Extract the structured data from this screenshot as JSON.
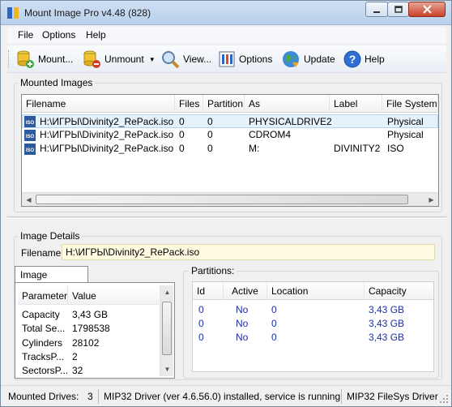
{
  "window": {
    "title": "Mount Image Pro v4.48 (828)"
  },
  "menu": [
    "File",
    "Options",
    "Help"
  ],
  "toolbar": {
    "mount": "Mount...",
    "unmount": "Unmount",
    "view": "View...",
    "options": "Options",
    "update": "Update",
    "help": "Help"
  },
  "mounted": {
    "group_label": "Mounted Images",
    "columns": [
      "Filename",
      "Files",
      "Partition",
      "As",
      "Label",
      "File System"
    ],
    "rows": [
      {
        "filename": "H:\\ИГРЫ\\Divinity2_RePack.iso",
        "files": "0",
        "partition": "0",
        "as": "PHYSICALDRIVE2",
        "label": "",
        "fs": "Physical",
        "icon": "iso-icon"
      },
      {
        "filename": "H:\\ИГРЫ\\Divinity2_RePack.iso",
        "files": "0",
        "partition": "0",
        "as": "CDROM4",
        "label": "",
        "fs": "Physical",
        "icon": "iso-icon"
      },
      {
        "filename": "H:\\ИГРЫ\\Divinity2_RePack.iso",
        "files": "0",
        "partition": "0",
        "as": "M:",
        "label": "DIVINITY2",
        "fs": "ISO",
        "icon": "iso-icon"
      }
    ]
  },
  "details": {
    "group_label": "Image Details",
    "filename_label": "Filename:",
    "filename_value": "H:\\ИГРЫ\\Divinity2_RePack.iso"
  },
  "properties": {
    "tab_label": "Image Properties",
    "columns": [
      "Parameter",
      "Value"
    ],
    "rows": [
      {
        "param": "Capacity",
        "value": "3,43 GB"
      },
      {
        "param": "Total Se...",
        "value": "1798538"
      },
      {
        "param": "Cylinders",
        "value": "28102"
      },
      {
        "param": "TracksP...",
        "value": "2"
      },
      {
        "param": "SectorsP...",
        "value": "32"
      }
    ]
  },
  "partitions": {
    "group_label": "Partitions:",
    "columns": [
      "Id",
      "Active",
      "Location",
      "Capacity"
    ],
    "rows": [
      {
        "id": "0",
        "active": "No",
        "location": "0",
        "capacity": "3,43 GB"
      },
      {
        "id": "0",
        "active": "No",
        "location": "0",
        "capacity": "3,43 GB"
      },
      {
        "id": "0",
        "active": "No",
        "location": "0",
        "capacity": "3,43 GB"
      }
    ]
  },
  "status": {
    "mounted_label": "Mounted Drives:",
    "mounted_count": "3",
    "driver": "MIP32 Driver (ver 4.6.56.0) installed, service is running",
    "fs_driver": "MIP32 FileSys Driver"
  },
  "colors": {
    "partition_text": "#1b2ea3",
    "selection": "#e5f1fb",
    "filename_field": "#fffbe0"
  }
}
